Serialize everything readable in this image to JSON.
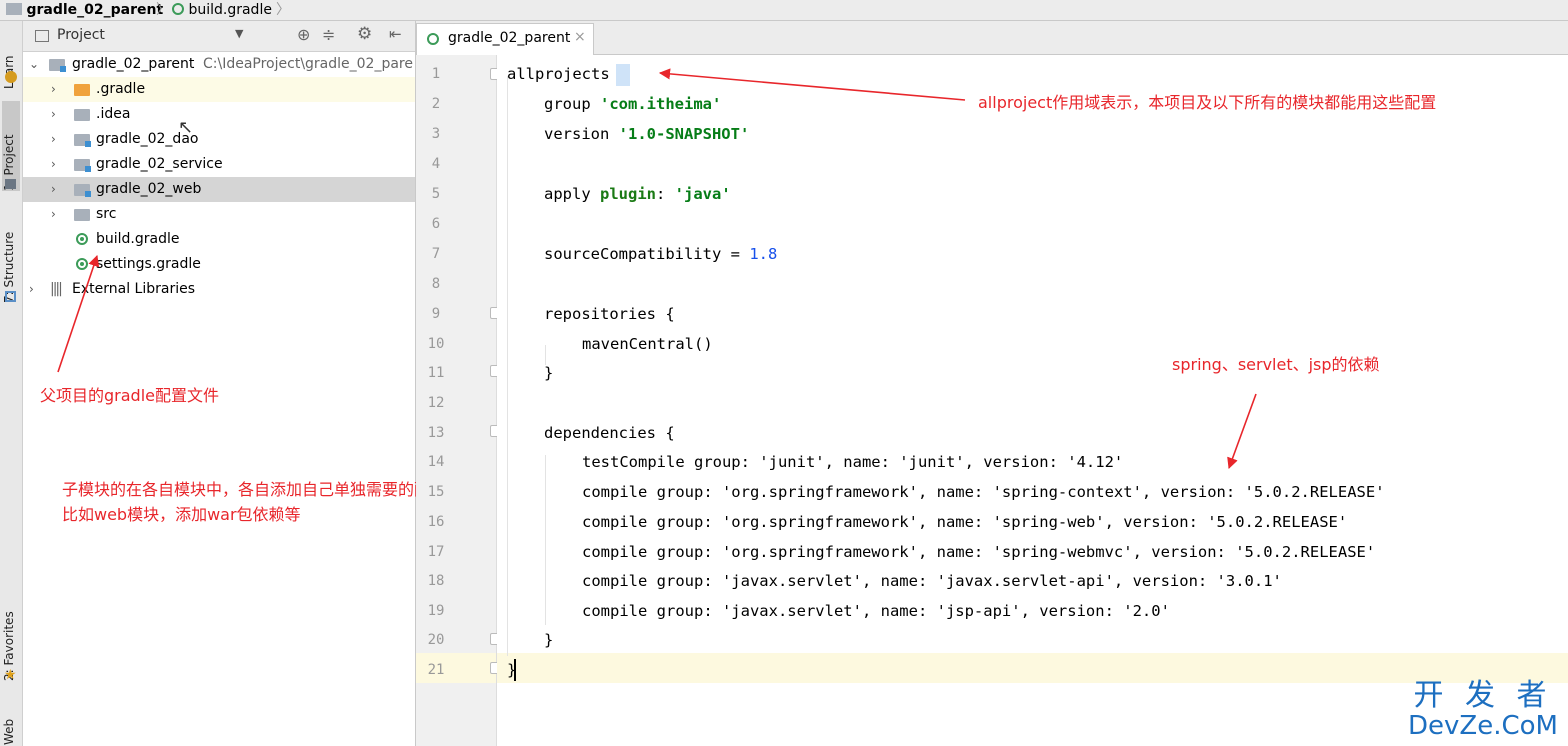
{
  "breadcrumb": {
    "project": "gradle_02_parent",
    "file": "build.gradle"
  },
  "toolstrip": {
    "learn": "Learn",
    "project": "1: Project",
    "structure": "7: Structure",
    "favorites": "2: Favorites",
    "web": "Web"
  },
  "project_panel": {
    "title": "Project",
    "tree": {
      "root": "gradle_02_parent",
      "root_path": "C:\\IdeaProject\\gradle_02_pare",
      "gradle_dir": ".gradle",
      "idea": ".idea",
      "dao": "gradle_02_dao",
      "service": "gradle_02_service",
      "web": "gradle_02_web",
      "src": "src",
      "build": "build.gradle",
      "settings": "settings.gradle",
      "libs": "External Libraries"
    }
  },
  "editor": {
    "tab_label": "gradle_02_parent",
    "tab_close": "×",
    "line_numbers": [
      "1",
      "2",
      "3",
      "4",
      "5",
      "6",
      "7",
      "8",
      "9",
      "10",
      "11",
      "12",
      "13",
      "14",
      "15",
      "16",
      "17",
      "18",
      "19",
      "20",
      "21"
    ],
    "code": {
      "l1": "allprojects {",
      "l2a": "group ",
      "l2b": "'com.itheima'",
      "l3a": "version ",
      "l3b": "'1.0-SNAPSHOT'",
      "l5a": "apply ",
      "l5b": "plugin",
      "l5c": ": ",
      "l5d": "'java'",
      "l7a": "sourceCompatibility = ",
      "l7b": "1.8",
      "l9": "repositories {",
      "l10": "mavenCentral()",
      "l11": "}",
      "l13": "dependencies {",
      "l14": "testCompile group: 'junit', name: 'junit', version: '4.12'",
      "l15": "compile group: 'org.springframework', name: 'spring-context', version: '5.0.2.RELEASE'",
      "l16": "compile group: 'org.springframework', name: 'spring-web', version: '5.0.2.RELEASE'",
      "l17": "compile group: 'org.springframework', name: 'spring-webmvc', version: '5.0.2.RELEASE'",
      "l18": "compile group: 'javax.servlet', name: 'javax.servlet-api', version: '3.0.1'",
      "l19": "compile group: 'javax.servlet', name: 'jsp-api', version: '2.0'",
      "l20": "}",
      "l21": "}"
    }
  },
  "annotations": {
    "allprojects": "allproject作用域表示，本项目及以下所有的模块都能用这些配置",
    "deps": "spring、servlet、jsp的依赖",
    "parent": "父项目的gradle配置文件",
    "child1": "子模块的在各自模块中，各自添加自己单独需要的配置项",
    "child2": "比如web模块，添加war包依赖等"
  },
  "watermark": {
    "top": "开 发 者",
    "bottom": "DevZe.CoM"
  },
  "colors": {
    "annotation": "#e8262b",
    "keyword": "#1a7a14",
    "number": "#1750eb",
    "watermark": "#1d6fc0"
  }
}
